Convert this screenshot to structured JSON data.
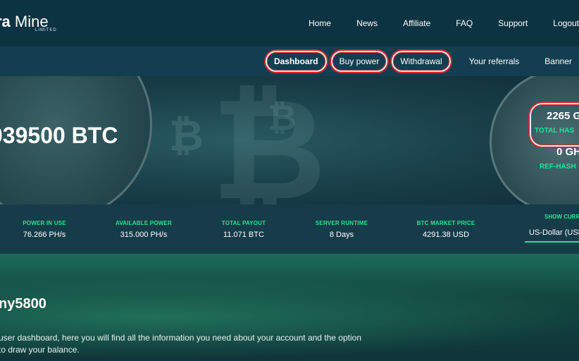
{
  "brand": {
    "name_strong": "ra",
    "name_rest": " Mine",
    "sub": "LIMITED"
  },
  "topnav": [
    "Home",
    "News",
    "Affiliate",
    "FAQ",
    "Support",
    "Logout"
  ],
  "subnav": [
    {
      "label": "Dashboard",
      "circled": true,
      "bold": true
    },
    {
      "label": "Buy power",
      "circled": true,
      "bold": false
    },
    {
      "label": "Withdrawal",
      "circled": true,
      "bold": false
    },
    {
      "label": "Your referrals",
      "circled": false,
      "bold": false
    },
    {
      "label": "Banner",
      "circled": false,
      "bold": false
    }
  ],
  "hero": {
    "balance": "039500 BTC",
    "hash_value": "2265 G",
    "hash_label": "TOTAL HAS",
    "ref_value": "0 GH",
    "ref_label": "REF-HASH"
  },
  "stats": [
    {
      "label": "POWER IN USE",
      "value": "76.266 PH/s"
    },
    {
      "label": "AVAILABLE POWER",
      "value": "315.000 PH/s"
    },
    {
      "label": "TOTAL PAYOUT",
      "value": "11.071 BTC"
    },
    {
      "label": "SERVER RUNTIME",
      "value": "8 Days"
    },
    {
      "label": "BTC MARKET PRICE",
      "value": "4291.38 USD"
    }
  ],
  "currency": {
    "label": "SHOW CURR",
    "selected": "US-Dollar (USD"
  },
  "main": {
    "greeting": "ny5800",
    "description": "user dashboard, here you will find all the information you need about your account and the option to draw your balance."
  },
  "colors": {
    "accent": "#27e28f",
    "circle": "#d0262e",
    "topbar": "#0c3342"
  }
}
